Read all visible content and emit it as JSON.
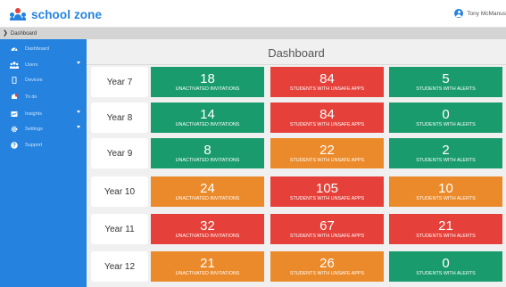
{
  "app": {
    "name": "school zone"
  },
  "user": {
    "name": "Tony McManus"
  },
  "breadcrumb": {
    "current": "Dashboard"
  },
  "sidebar": {
    "items": [
      {
        "label": "Dashboard",
        "icon": "dashboard-icon",
        "caret": false
      },
      {
        "label": "Users",
        "icon": "users-icon",
        "caret": true
      },
      {
        "label": "Devices",
        "icon": "device-icon",
        "caret": false
      },
      {
        "label": "To do",
        "icon": "todo-icon",
        "caret": false
      },
      {
        "label": "Insights",
        "icon": "insights-icon",
        "caret": true
      },
      {
        "label": "Settings",
        "icon": "gear-icon",
        "caret": true
      },
      {
        "label": "Support",
        "icon": "help-icon",
        "caret": false
      }
    ]
  },
  "page": {
    "title": "Dashboard"
  },
  "colors": {
    "green": "#1a9b6e",
    "red": "#e5413a",
    "orange": "#eb8a2a",
    "blue": "#2583df"
  },
  "rows": [
    {
      "year": "Year 7",
      "cells": [
        {
          "value": "18",
          "label": "UNACTIVATED INVITATIONS",
          "status": "green"
        },
        {
          "value": "84",
          "label": "STUDENTS WITH UNSAFE APPS",
          "status": "red"
        },
        {
          "value": "5",
          "label": "STUDENTS WITH ALERTS",
          "status": "green"
        }
      ]
    },
    {
      "year": "Year 8",
      "cells": [
        {
          "value": "14",
          "label": "UNACTIVATED INVITATIONS",
          "status": "green"
        },
        {
          "value": "84",
          "label": "STUDENTS WITH UNSAFE APPS",
          "status": "red"
        },
        {
          "value": "0",
          "label": "STUDENTS WITH ALERTS",
          "status": "green"
        }
      ]
    },
    {
      "year": "Year 9",
      "cells": [
        {
          "value": "8",
          "label": "UNACTIVATED INVITATIONS",
          "status": "green"
        },
        {
          "value": "22",
          "label": "STUDENTS WITH UNSAFE APPS",
          "status": "orange"
        },
        {
          "value": "2",
          "label": "STUDENTS WITH ALERTS",
          "status": "green"
        }
      ]
    },
    {
      "year": "Year 10",
      "cells": [
        {
          "value": "24",
          "label": "UNACTIVATED INVITATIONS",
          "status": "orange"
        },
        {
          "value": "105",
          "label": "STUDENTS WITH UNSAFE APPS",
          "status": "red"
        },
        {
          "value": "10",
          "label": "STUDENTS WITH ALERTS",
          "status": "orange"
        }
      ]
    },
    {
      "year": "Year 11",
      "cells": [
        {
          "value": "32",
          "label": "UNACTIVATED INVITATIONS",
          "status": "red"
        },
        {
          "value": "67",
          "label": "STUDENTS WITH UNSAFE APPS",
          "status": "red"
        },
        {
          "value": "21",
          "label": "STUDENTS WITH ALERTS",
          "status": "red"
        }
      ]
    },
    {
      "year": "Year 12",
      "cells": [
        {
          "value": "21",
          "label": "UNACTIVATED INVITATIONS",
          "status": "orange"
        },
        {
          "value": "26",
          "label": "STUDENTS WITH UNSAFE APPS",
          "status": "orange"
        },
        {
          "value": "0",
          "label": "STUDENTS WITH ALERTS",
          "status": "green"
        }
      ]
    }
  ]
}
